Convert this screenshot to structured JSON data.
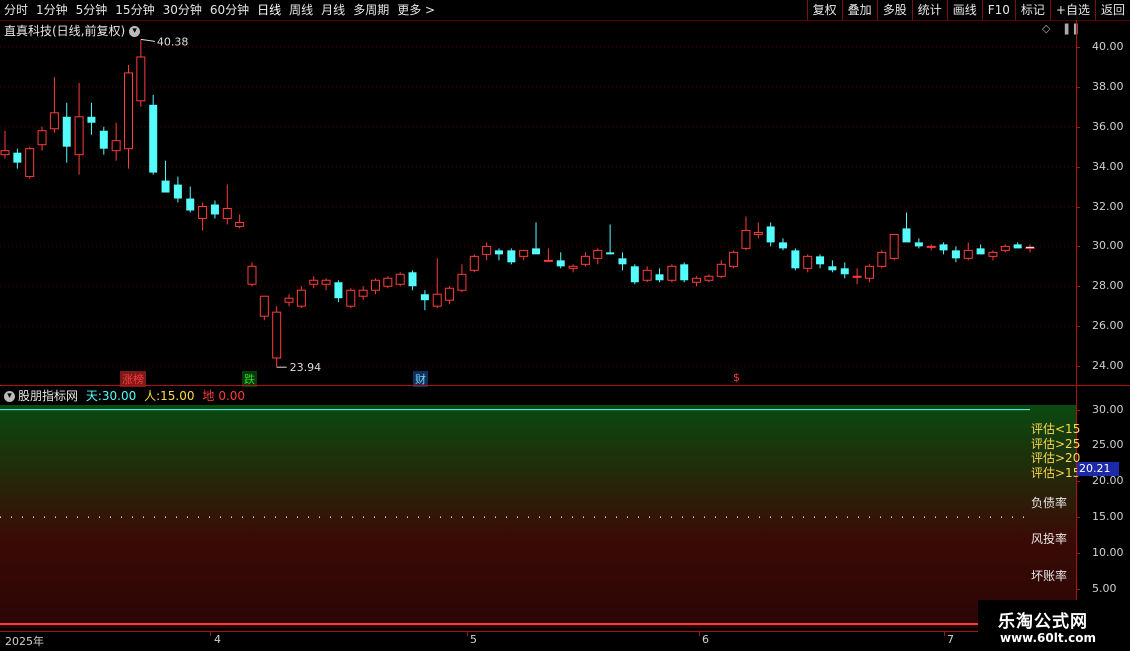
{
  "toolbar": {
    "periods": [
      "分时",
      "1分钟",
      "5分钟",
      "15分钟",
      "30分钟",
      "60分钟",
      "日线",
      "周线",
      "月线",
      "多周期",
      "更多 >"
    ],
    "buttons": [
      "复权",
      "叠加",
      "多股",
      "统计",
      "画线",
      "F10",
      "标记",
      "+自选",
      "返回"
    ]
  },
  "main": {
    "title": "直真科技(日线,前复权)",
    "high_label": "40.38",
    "low_label": "23.94",
    "y_ticks": [
      "40.00",
      "38.00",
      "36.00",
      "34.00",
      "32.00",
      "30.00",
      "28.00",
      "26.00",
      "24.00"
    ],
    "event_tags": [
      {
        "text": "涨榜",
        "color": "#ff3b3b",
        "bg": "#7a1a1a"
      },
      {
        "text": "跌",
        "color": "#22dd22",
        "bg": "#0a3a0a"
      },
      {
        "text": "财",
        "color": "#7ad0ff",
        "bg": "#10305a"
      },
      {
        "text": "$",
        "color": "#ff3b3b",
        "bg": "#000"
      }
    ]
  },
  "indicator": {
    "name": "股朋指标网",
    "tian_label": "天:",
    "tian_value": "30.00",
    "ren_label": "人:",
    "ren_value": "15.00",
    "di_label": "地",
    "di_value": "0.00",
    "y_ticks": [
      "30.00",
      "25.00",
      "20.00",
      "15.00",
      "10.00",
      "5.00"
    ],
    "current_value": "20.21",
    "ratings": [
      "评估<15",
      "评估>25",
      "评估>20",
      "评估>15"
    ],
    "right_labels": [
      "负债率",
      "风投率",
      "坏账率"
    ]
  },
  "x_axis": {
    "labels": [
      "2025年",
      "4",
      "5",
      "6",
      "7"
    ]
  },
  "watermark": {
    "main": "乐淘公式网",
    "sub": "www.60lt.com"
  },
  "colors": {
    "up": "#ff3b3b",
    "down": "#54fcfc",
    "grid": "#5a0000",
    "axis": "#b01010"
  },
  "chart_data": {
    "type": "candlestick",
    "title": "直真科技(日线,前复权)",
    "ylim": [
      23.5,
      41.0
    ],
    "candles": [
      {
        "o": 34.6,
        "h": 35.8,
        "l": 34.4,
        "c": 34.8
      },
      {
        "o": 34.7,
        "h": 34.9,
        "l": 33.9,
        "c": 34.2
      },
      {
        "o": 33.5,
        "h": 35.0,
        "l": 33.4,
        "c": 34.9
      },
      {
        "o": 35.1,
        "h": 36.0,
        "l": 34.8,
        "c": 35.8
      },
      {
        "o": 35.9,
        "h": 38.5,
        "l": 35.7,
        "c": 36.7
      },
      {
        "o": 36.5,
        "h": 37.2,
        "l": 34.2,
        "c": 35.0
      },
      {
        "o": 34.6,
        "h": 38.2,
        "l": 33.6,
        "c": 36.5
      },
      {
        "o": 36.5,
        "h": 37.2,
        "l": 35.6,
        "c": 36.2
      },
      {
        "o": 35.8,
        "h": 36.0,
        "l": 34.6,
        "c": 34.9
      },
      {
        "o": 34.8,
        "h": 36.2,
        "l": 34.3,
        "c": 35.3
      },
      {
        "o": 34.9,
        "h": 39.1,
        "l": 33.9,
        "c": 38.7
      },
      {
        "o": 37.3,
        "h": 40.38,
        "l": 37.0,
        "c": 39.5
      },
      {
        "o": 37.1,
        "h": 37.6,
        "l": 33.6,
        "c": 33.7
      },
      {
        "o": 33.3,
        "h": 34.3,
        "l": 32.9,
        "c": 32.7
      },
      {
        "o": 33.1,
        "h": 33.5,
        "l": 32.2,
        "c": 32.4
      },
      {
        "o": 32.4,
        "h": 33.0,
        "l": 31.7,
        "c": 31.8
      },
      {
        "o": 31.4,
        "h": 32.2,
        "l": 30.8,
        "c": 32.0
      },
      {
        "o": 32.1,
        "h": 32.3,
        "l": 31.4,
        "c": 31.6
      },
      {
        "o": 31.4,
        "h": 33.1,
        "l": 31.1,
        "c": 31.9
      },
      {
        "o": 31.0,
        "h": 31.6,
        "l": 30.9,
        "c": 31.2
      },
      {
        "o": 28.1,
        "h": 29.2,
        "l": 28.0,
        "c": 29.0
      },
      {
        "o": 26.5,
        "h": 27.4,
        "l": 26.3,
        "c": 27.5
      },
      {
        "o": 24.4,
        "h": 27.0,
        "l": 23.94,
        "c": 26.7
      },
      {
        "o": 27.2,
        "h": 27.6,
        "l": 27.0,
        "c": 27.4
      },
      {
        "o": 27.0,
        "h": 28.0,
        "l": 26.9,
        "c": 27.8
      },
      {
        "o": 28.1,
        "h": 28.5,
        "l": 27.9,
        "c": 28.3
      },
      {
        "o": 28.1,
        "h": 28.4,
        "l": 27.8,
        "c": 28.3
      },
      {
        "o": 28.2,
        "h": 28.3,
        "l": 27.2,
        "c": 27.4
      },
      {
        "o": 27.0,
        "h": 27.9,
        "l": 26.9,
        "c": 27.8
      },
      {
        "o": 27.5,
        "h": 28.0,
        "l": 27.3,
        "c": 27.8
      },
      {
        "o": 27.8,
        "h": 28.4,
        "l": 27.6,
        "c": 28.3
      },
      {
        "o": 28.0,
        "h": 28.5,
        "l": 27.9,
        "c": 28.4
      },
      {
        "o": 28.1,
        "h": 28.7,
        "l": 28.0,
        "c": 28.6
      },
      {
        "o": 28.7,
        "h": 28.8,
        "l": 27.8,
        "c": 28.0
      },
      {
        "o": 27.6,
        "h": 27.8,
        "l": 26.8,
        "c": 27.3
      },
      {
        "o": 27.0,
        "h": 29.4,
        "l": 26.9,
        "c": 27.6
      },
      {
        "o": 27.3,
        "h": 28.0,
        "l": 27.1,
        "c": 27.9
      },
      {
        "o": 27.8,
        "h": 29.1,
        "l": 27.7,
        "c": 28.6
      },
      {
        "o": 28.8,
        "h": 29.6,
        "l": 28.7,
        "c": 29.5
      },
      {
        "o": 29.6,
        "h": 30.2,
        "l": 29.3,
        "c": 30.0
      },
      {
        "o": 29.8,
        "h": 29.9,
        "l": 29.3,
        "c": 29.6
      },
      {
        "o": 29.8,
        "h": 29.9,
        "l": 29.1,
        "c": 29.2
      },
      {
        "o": 29.5,
        "h": 29.8,
        "l": 29.3,
        "c": 29.8
      },
      {
        "o": 29.9,
        "h": 31.2,
        "l": 29.7,
        "c": 29.6
      },
      {
        "o": 29.3,
        "h": 29.9,
        "l": 29.2,
        "c": 29.3
      },
      {
        "o": 29.3,
        "h": 29.7,
        "l": 28.9,
        "c": 29.0
      },
      {
        "o": 28.9,
        "h": 29.1,
        "l": 28.7,
        "c": 29.0
      },
      {
        "o": 29.1,
        "h": 29.7,
        "l": 29.0,
        "c": 29.5
      },
      {
        "o": 29.4,
        "h": 29.9,
        "l": 29.1,
        "c": 29.8
      },
      {
        "o": 29.7,
        "h": 31.1,
        "l": 29.6,
        "c": 29.6
      },
      {
        "o": 29.4,
        "h": 29.7,
        "l": 28.8,
        "c": 29.1
      },
      {
        "o": 29.0,
        "h": 29.1,
        "l": 28.1,
        "c": 28.2
      },
      {
        "o": 28.3,
        "h": 29.0,
        "l": 28.2,
        "c": 28.8
      },
      {
        "o": 28.6,
        "h": 28.9,
        "l": 28.2,
        "c": 28.3
      },
      {
        "o": 28.3,
        "h": 29.1,
        "l": 28.2,
        "c": 29.0
      },
      {
        "o": 29.1,
        "h": 29.2,
        "l": 28.2,
        "c": 28.3
      },
      {
        "o": 28.2,
        "h": 28.5,
        "l": 28.0,
        "c": 28.4
      },
      {
        "o": 28.3,
        "h": 28.6,
        "l": 28.2,
        "c": 28.5
      },
      {
        "o": 28.5,
        "h": 29.3,
        "l": 28.4,
        "c": 29.1
      },
      {
        "o": 29.0,
        "h": 29.8,
        "l": 28.9,
        "c": 29.7
      },
      {
        "o": 29.9,
        "h": 31.5,
        "l": 29.8,
        "c": 30.8
      },
      {
        "o": 30.6,
        "h": 31.2,
        "l": 30.4,
        "c": 30.7
      },
      {
        "o": 31.0,
        "h": 31.2,
        "l": 30.0,
        "c": 30.2
      },
      {
        "o": 30.2,
        "h": 30.4,
        "l": 29.8,
        "c": 29.9
      },
      {
        "o": 29.8,
        "h": 29.9,
        "l": 28.8,
        "c": 28.9
      },
      {
        "o": 28.9,
        "h": 29.6,
        "l": 28.7,
        "c": 29.5
      },
      {
        "o": 29.5,
        "h": 29.6,
        "l": 28.9,
        "c": 29.1
      },
      {
        "o": 29.0,
        "h": 29.3,
        "l": 28.7,
        "c": 28.8
      },
      {
        "o": 28.9,
        "h": 29.2,
        "l": 28.4,
        "c": 28.6
      },
      {
        "o": 28.5,
        "h": 28.9,
        "l": 28.1,
        "c": 28.5
      },
      {
        "o": 28.4,
        "h": 29.1,
        "l": 28.2,
        "c": 29.0
      },
      {
        "o": 29.0,
        "h": 29.8,
        "l": 28.9,
        "c": 29.7
      },
      {
        "o": 29.4,
        "h": 30.6,
        "l": 29.3,
        "c": 30.6
      },
      {
        "o": 30.9,
        "h": 31.7,
        "l": 30.3,
        "c": 30.2
      },
      {
        "o": 30.2,
        "h": 30.4,
        "l": 29.9,
        "c": 30.0
      },
      {
        "o": 30.0,
        "h": 30.1,
        "l": 29.8,
        "c": 30.0
      },
      {
        "o": 30.1,
        "h": 30.2,
        "l": 29.6,
        "c": 29.8
      },
      {
        "o": 29.8,
        "h": 30.0,
        "l": 29.2,
        "c": 29.4
      },
      {
        "o": 29.4,
        "h": 30.2,
        "l": 29.3,
        "c": 29.8
      },
      {
        "o": 29.9,
        "h": 30.1,
        "l": 29.6,
        "c": 29.6
      },
      {
        "o": 29.5,
        "h": 29.8,
        "l": 29.3,
        "c": 29.7
      },
      {
        "o": 29.8,
        "h": 30.1,
        "l": 29.7,
        "c": 30.0
      },
      {
        "o": 30.1,
        "h": 30.2,
        "l": 29.9,
        "c": 29.9
      },
      {
        "o": 29.95,
        "h": 30.1,
        "l": 29.7,
        "c": 29.95
      }
    ],
    "indicator_lines": [
      {
        "name": "天",
        "value": 30.0,
        "color": "#54fcfc"
      },
      {
        "name": "人",
        "value": 15.0,
        "color": "#ffd84a"
      },
      {
        "name": "地",
        "value": 0.0,
        "color": "#ff3b3b"
      }
    ],
    "indicator_ylim": [
      0,
      32
    ],
    "indicator_current": 20.21
  }
}
